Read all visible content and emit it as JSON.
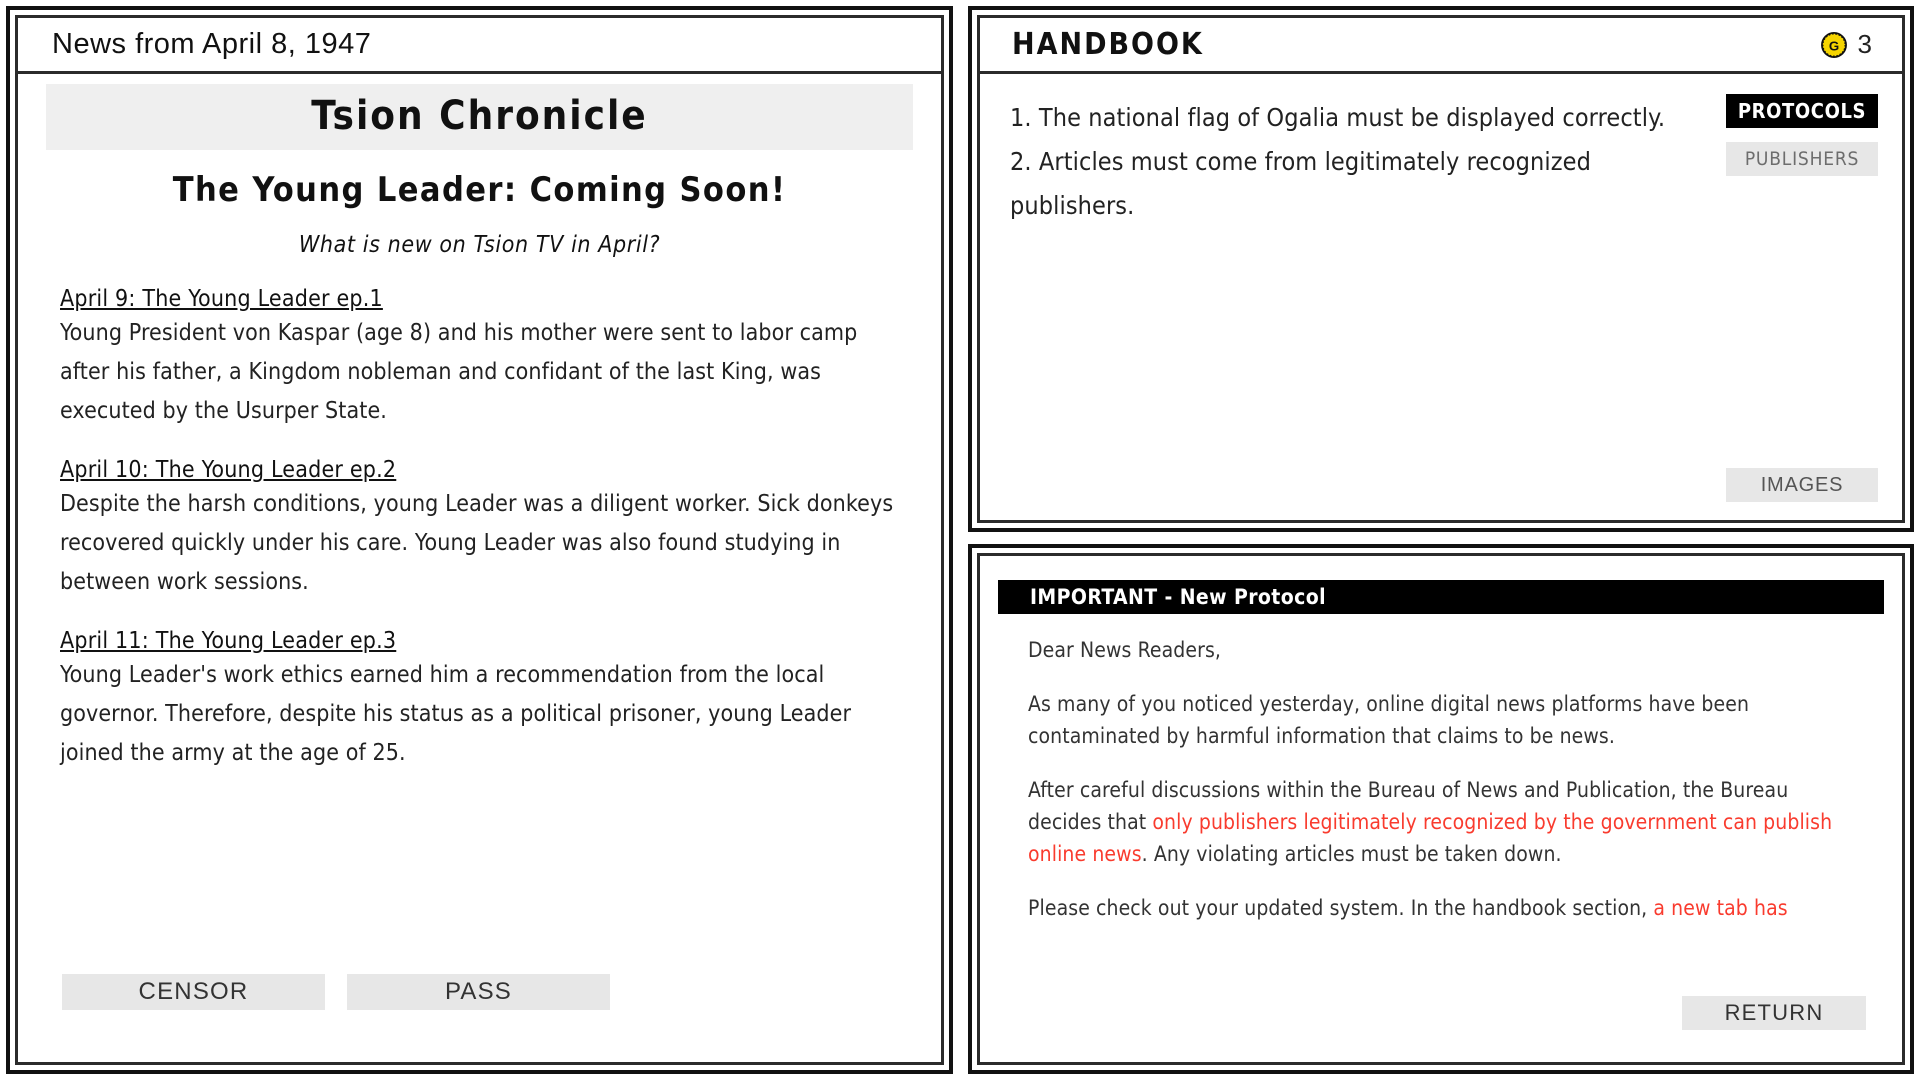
{
  "news_panel": {
    "header": "News from April 8, 1947",
    "masthead": "Tsion Chronicle",
    "headline": "The Young Leader: Coming Soon!",
    "subhead": "What is new on Tsion TV in April?",
    "articles": [
      {
        "date": "April 9: The Young Leader ep.1",
        "text": "Young President von Kaspar (age 8) and his mother were sent to labor camp after his father, a Kingdom nobleman and confidant of the last King, was executed by the Usurper State."
      },
      {
        "date": "April 10: The Young Leader ep.2",
        "text": "Despite the harsh conditions, young Leader was a diligent worker. Sick donkeys recovered quickly under his care. Young Leader was also found studying in between work sessions."
      },
      {
        "date": "April 11: The Young Leader ep.3",
        "text": "Young Leader's work ethics earned him a recommendation from the local governor. Therefore, despite his status as a political prisoner, young Leader joined the army at the age of 25."
      }
    ],
    "censor_label": "CENSOR",
    "pass_label": "PASS"
  },
  "handbook_panel": {
    "title": "HANDBOOK",
    "currency": {
      "icon": "gold-coin-icon",
      "symbol": "G",
      "amount": "3",
      "color": "#f5d400"
    },
    "rules": [
      "1. The national flag of Ogalia must be displayed correctly.",
      "2. Articles must come from legitimately recognized publishers."
    ],
    "tabs": [
      {
        "label": "PROTOCOLS",
        "state": "active"
      },
      {
        "label": "PUBLISHERS",
        "state": "idle"
      }
    ],
    "lower_tab": {
      "label": "IMAGES",
      "state": "idle"
    }
  },
  "memo_panel": {
    "banner": "IMPORTANT - New Protocol",
    "paragraphs": [
      {
        "parts": [
          {
            "text": "Dear News Readers,",
            "color": "default"
          }
        ]
      },
      {
        "parts": [
          {
            "text": "As many of you noticed yesterday, online digital news platforms have been contaminated by harmful information that claims to be news.",
            "color": "default"
          }
        ]
      },
      {
        "parts": [
          {
            "text": "After careful discussions within the Bureau of News and Publication, the Bureau decides that ",
            "color": "default"
          },
          {
            "text": "only publishers legitimately recognized by the government can publish online news",
            "color": "red"
          },
          {
            "text": ". Any violating articles must be taken down.",
            "color": "default"
          }
        ]
      },
      {
        "parts": [
          {
            "text": "Please check out your updated system. In the handbook section, ",
            "color": "default"
          },
          {
            "text": "a new tab has",
            "color": "red"
          }
        ]
      }
    ],
    "return_label": "RETURN",
    "highlight_color": "#f93b2e"
  }
}
